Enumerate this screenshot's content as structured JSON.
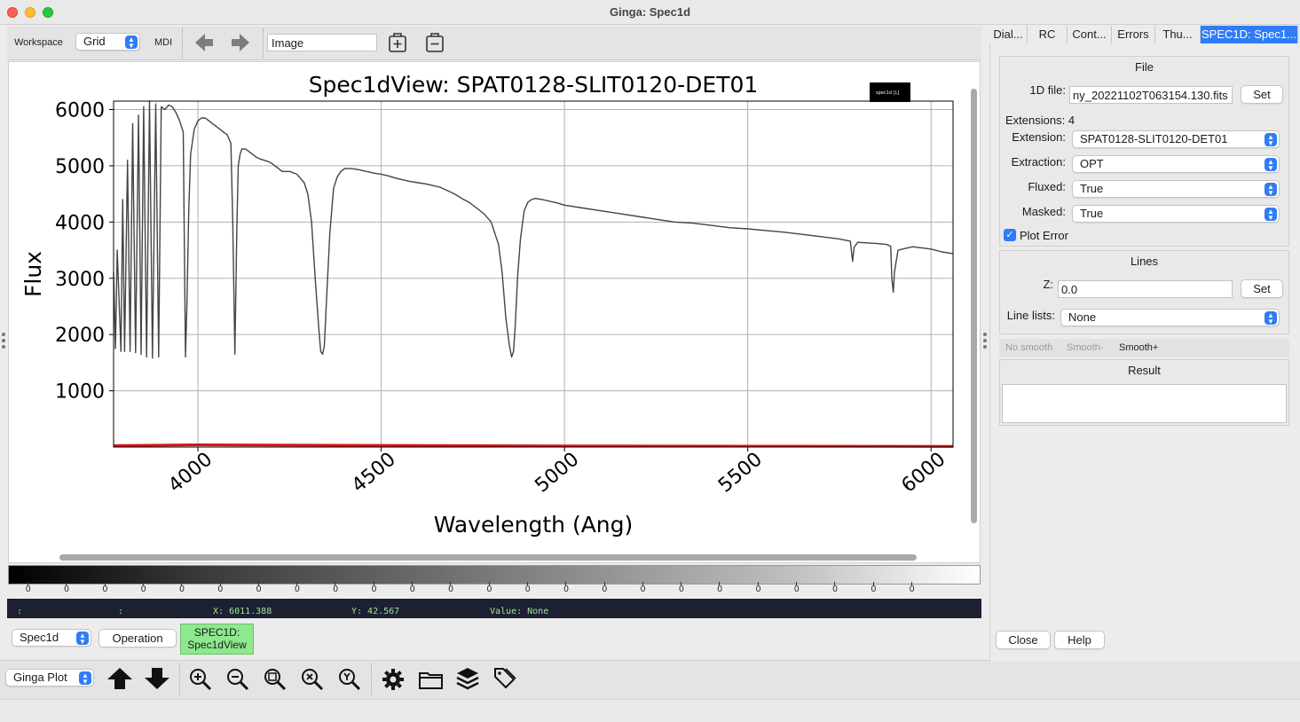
{
  "window": {
    "title": "Ginga: Spec1d"
  },
  "toolbar": {
    "workspace_label": "Workspace",
    "workspace_value": "Grid",
    "mdi_label": "MDI",
    "image_field": "Image",
    "icons": [
      "arrow-left-icon",
      "arrow-right-icon",
      "add-channel-icon",
      "remove-channel-icon"
    ]
  },
  "chart_data": {
    "type": "line",
    "title": "Spec1dView: SPAT0128-SLIT0120-DET01",
    "xlabel": "Wavelength (Ang)",
    "ylabel": "Flux",
    "xlim": [
      3770,
      6060
    ],
    "ylim": [
      0,
      6150
    ],
    "xticks": [
      4000,
      4500,
      5000,
      5500,
      6000
    ],
    "yticks": [
      1000,
      2000,
      3000,
      4000,
      5000,
      6000
    ],
    "grid": true,
    "legend_text": "spec1d [L]",
    "legend_position": "top-right",
    "series": [
      {
        "color": "#444444",
        "x": [
          3770,
          3775,
          3780,
          3790,
          3795,
          3800,
          3808,
          3815,
          3822,
          3830,
          3838,
          3845,
          3852,
          3860,
          3868,
          3876,
          3885,
          3893,
          3900,
          3910,
          3920,
          3930,
          3940,
          3950,
          3960,
          3966,
          3970,
          3975,
          3980,
          3990,
          4000,
          4010,
          4020,
          4030,
          4040,
          4050,
          4060,
          4070,
          4080,
          4090,
          4095,
          4101,
          4106,
          4110,
          4115,
          4120,
          4130,
          4140,
          4150,
          4160,
          4170,
          4180,
          4190,
          4200,
          4210,
          4220,
          4230,
          4250,
          4270,
          4290,
          4300,
          4310,
          4320,
          4330,
          4335,
          4340,
          4345,
          4350,
          4360,
          4370,
          4380,
          4390,
          4400,
          4420,
          4440,
          4460,
          4480,
          4500,
          4520,
          4540,
          4560,
          4580,
          4600,
          4620,
          4640,
          4660,
          4680,
          4700,
          4720,
          4740,
          4760,
          4780,
          4800,
          4820,
          4830,
          4840,
          4850,
          4856,
          4861,
          4866,
          4872,
          4880,
          4890,
          4900,
          4910,
          4920,
          4940,
          4960,
          4980,
          5000,
          5050,
          5100,
          5150,
          5200,
          5250,
          5300,
          5350,
          5400,
          5450,
          5500,
          5550,
          5600,
          5650,
          5700,
          5750,
          5780,
          5786,
          5790,
          5800,
          5850,
          5880,
          5890,
          5893,
          5897,
          5900,
          5910,
          5950,
          6000,
          6030,
          6060
        ],
        "y": [
          3100,
          1750,
          3500,
          1700,
          4400,
          1700,
          5100,
          1700,
          5750,
          1680,
          5900,
          1650,
          6050,
          1600,
          6150,
          1580,
          6100,
          1600,
          6050,
          6000,
          6080,
          6050,
          5950,
          5800,
          5600,
          1600,
          2500,
          4200,
          5200,
          5650,
          5800,
          5850,
          5850,
          5800,
          5750,
          5700,
          5650,
          5600,
          5550,
          5400,
          4000,
          1650,
          3800,
          5000,
          5200,
          5300,
          5300,
          5250,
          5200,
          5150,
          5120,
          5100,
          5080,
          5050,
          5000,
          4950,
          4900,
          4900,
          4850,
          4700,
          4500,
          4000,
          3000,
          2100,
          1700,
          1650,
          1800,
          2500,
          3800,
          4600,
          4800,
          4900,
          4950,
          4950,
          4930,
          4900,
          4870,
          4850,
          4820,
          4780,
          4750,
          4720,
          4700,
          4680,
          4650,
          4620,
          4560,
          4500,
          4420,
          4350,
          4250,
          4150,
          4000,
          3600,
          3100,
          2300,
          1800,
          1600,
          1700,
          2200,
          3000,
          3700,
          4200,
          4350,
          4400,
          4420,
          4400,
          4370,
          4340,
          4300,
          4250,
          4200,
          4150,
          4100,
          4050,
          4000,
          3980,
          3940,
          3900,
          3880,
          3850,
          3820,
          3780,
          3740,
          3700,
          3660,
          3300,
          3550,
          3640,
          3620,
          3600,
          3570,
          3000,
          2750,
          3100,
          3500,
          3560,
          3520,
          3470,
          3440
        ],
        "name": ""
      },
      {
        "color": "#dd1111",
        "x": [
          3770,
          4000,
          4500,
          5000,
          5500,
          6060
        ],
        "y": [
          25,
          40,
          30,
          20,
          15,
          12
        ],
        "name": ""
      }
    ]
  },
  "colorbar": {
    "tick_labels": [
      "0",
      "0",
      "0",
      "0",
      "0",
      "0",
      "0",
      "0",
      "0",
      "0",
      "0",
      "0",
      "0",
      "0",
      "0",
      "0",
      "0",
      "0",
      "0",
      "0",
      "0",
      "0",
      "0",
      "0"
    ]
  },
  "readout": {
    "col1": ":",
    "col2": ":",
    "x": "X: 6011.388",
    "y": "Y: 42.567",
    "value": "Value: None"
  },
  "plugin_bar": {
    "plugin_combo": "Spec1d",
    "operation_button": "Operation",
    "active_plugin_line1": "SPEC1D:",
    "active_plugin_line2": "Spec1dView"
  },
  "bottom_toolbar": {
    "viewer_combo": "Ginga Plot",
    "icons": [
      "arrow-up-icon",
      "arrow-down-icon",
      "zoom-in-icon",
      "zoom-out-icon",
      "zoom-fit-icon",
      "zoom-x-icon",
      "zoom-y-icon",
      "gear-icon",
      "folder-icon",
      "layers-icon",
      "tags-icon"
    ]
  },
  "right_panel": {
    "tabs": [
      "Dial...",
      "RC",
      "Cont...",
      "Errors",
      "Thu...",
      "SPEC1D: Spec1..."
    ],
    "active_tab": 5,
    "file_group": {
      "title": "File",
      "file_label": "1D file:",
      "file_value": "ny_20221102T063154.130.fits",
      "set_button": "Set",
      "extensions_text": "Extensions: 4",
      "extension_label": "Extension:",
      "extension_value": "SPAT0128-SLIT0120-DET01",
      "extraction_label": "Extraction:",
      "extraction_value": "OPT",
      "fluxed_label": "Fluxed:",
      "fluxed_value": "True",
      "masked_label": "Masked:",
      "masked_value": "True",
      "plot_error_label": "Plot Error",
      "plot_error_checked": true
    },
    "lines_group": {
      "title": "Lines",
      "z_label": "Z:",
      "z_value": "0.0",
      "set_button": "Set",
      "linelists_label": "Line lists:",
      "linelists_value": "None"
    },
    "smooth": {
      "none": "No smooth",
      "minus": "Smooth-",
      "plus": "Smooth+"
    },
    "result_title": "Result",
    "close_button": "Close",
    "help_button": "Help"
  },
  "colors": {
    "accent": "#2f7cf6",
    "active_plugin": "#8ee88e",
    "readout_bg": "#1c2030",
    "readout_fg": "#9fe39f"
  }
}
